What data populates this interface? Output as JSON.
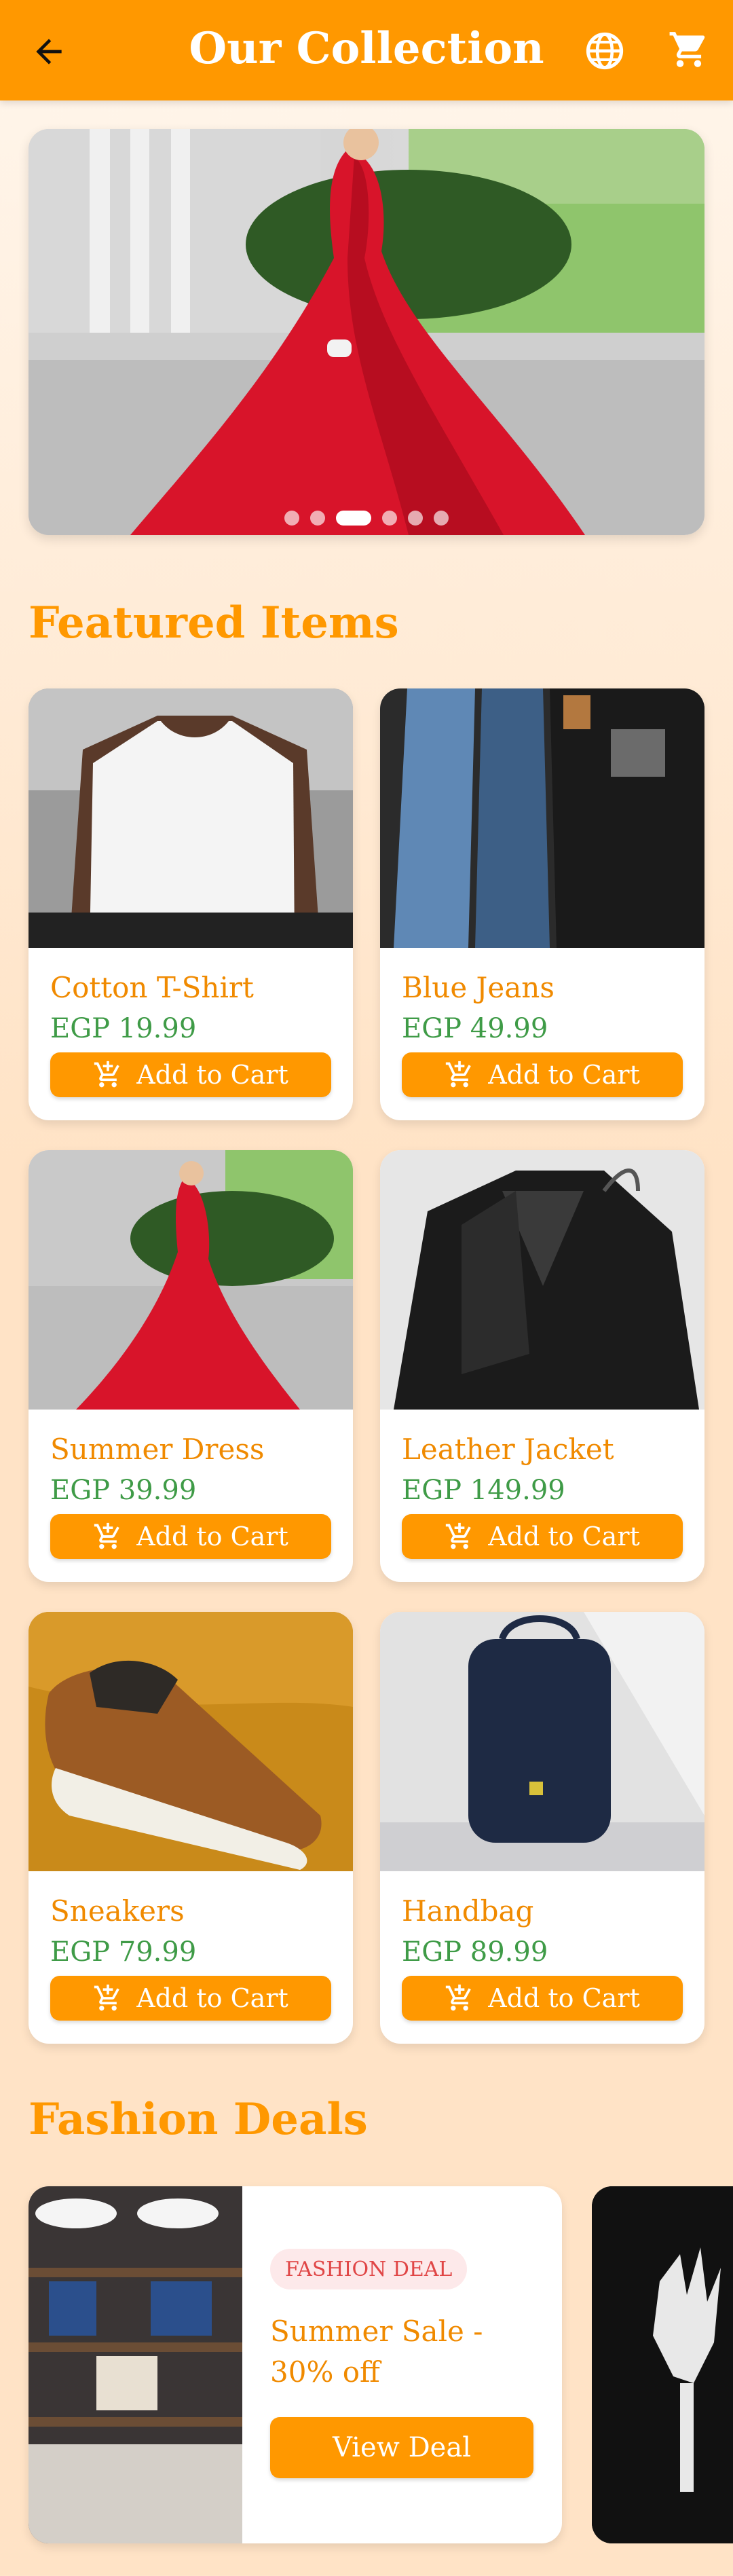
{
  "app_bar": {
    "title": "Our Collection",
    "back_icon": "arrow-left-icon",
    "language_icon": "globe-icon",
    "cart_icon": "shopping-cart-icon",
    "background": "#ff9800"
  },
  "carousel": {
    "slide_count": 6,
    "active_index": 2
  },
  "featured": {
    "title": "Featured Items",
    "products": [
      {
        "name": "Cotton T-Shirt",
        "price": "EGP 19.99",
        "button": "Add to Cart"
      },
      {
        "name": "Blue Jeans",
        "price": "EGP 49.99",
        "button": "Add to Cart"
      },
      {
        "name": "Summer Dress",
        "price": "EGP 39.99",
        "button": "Add to Cart"
      },
      {
        "name": "Leather Jacket",
        "price": "EGP 149.99",
        "button": "Add to Cart"
      },
      {
        "name": "Sneakers",
        "price": "EGP 79.99",
        "button": "Add to Cart"
      },
      {
        "name": "Handbag",
        "price": "EGP 89.99",
        "button": "Add to Cart"
      }
    ]
  },
  "deals": {
    "title": "Fashion Deals",
    "items": [
      {
        "badge": "FASHION DEAL",
        "title": "Summer Sale - 30% off",
        "button": "View Deal"
      }
    ]
  },
  "colors": {
    "accent": "#ff9800",
    "price": "#3f9b47",
    "badge_text": "#e04646",
    "badge_bg": "#fde9ea"
  }
}
